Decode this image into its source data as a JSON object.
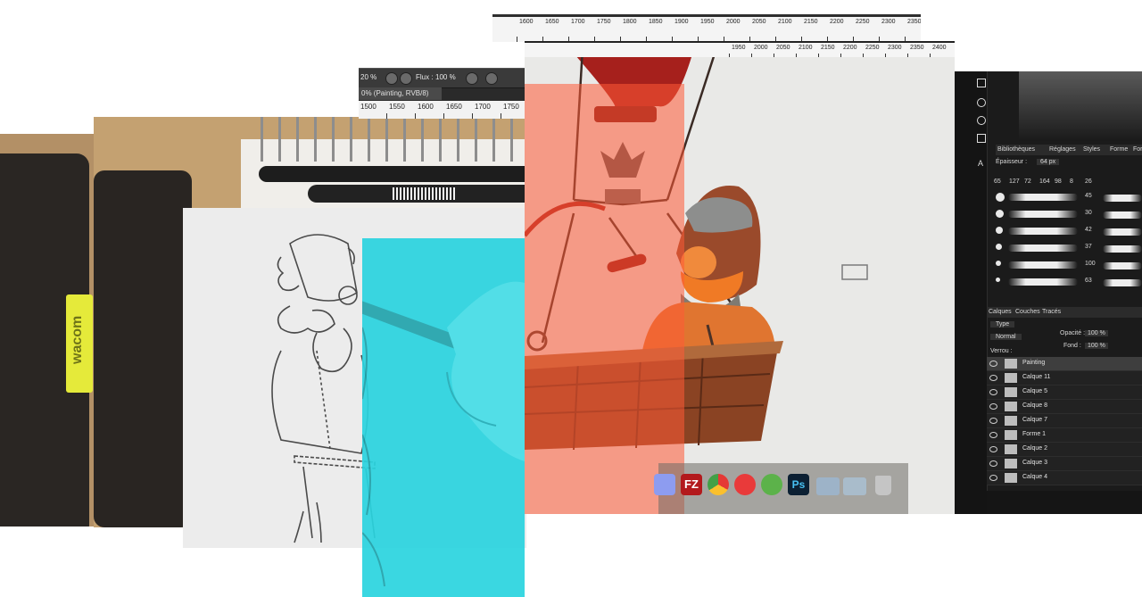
{
  "tablet_brand": "wacom",
  "toolbar": {
    "zoom_value": "20 %",
    "flux_label": "Flux :",
    "flux_value": "100 %",
    "doc_tab": "0% (Painting, RVB/8)"
  },
  "ruler_small": [
    "1500",
    "1550",
    "1600",
    "1650",
    "1700",
    "1750"
  ],
  "ruler_back": [
    "1600",
    "1650",
    "1700",
    "1750",
    "1800",
    "1850",
    "1900",
    "1950",
    "2000",
    "2050",
    "2100",
    "2150",
    "2200",
    "2250",
    "2300",
    "2350"
  ],
  "ruler_front": [
    "1950",
    "2000",
    "2050",
    "2100",
    "2150",
    "2200",
    "2250",
    "2300",
    "2350",
    "2400"
  ],
  "dock_apps": [
    "finder-icon",
    "filezilla-icon",
    "chrome-icon",
    "itunes-icon",
    "spotify-icon",
    "photoshop-icon",
    "folder-icon",
    "folder-icon",
    "trash-icon"
  ],
  "dock_labels": {
    "filezilla": "FZ",
    "photoshop": "Ps"
  },
  "panels": {
    "tabs_top": [
      "Bibliothèques",
      "Réglages",
      "Styles",
      "Forme",
      "Formes prédéfinies"
    ],
    "epaisseur_label": "Épaisseur :",
    "epaisseur_value": "64 px",
    "brush_sizes": [
      "65",
      "127",
      "72",
      "164",
      "98",
      "8",
      "26"
    ],
    "brush_side_sizes": [
      "45",
      "30",
      "42",
      "37",
      "100",
      "63"
    ],
    "layer_tabs": [
      "Calques",
      "Couches",
      "Tracés"
    ],
    "type_filter": "Type",
    "blend_mode": "Normal",
    "opacity_label": "Opacité :",
    "opacity_value": "100 %",
    "fill_label": "Fond :",
    "fill_value": "100 %",
    "lock_label": "Verrou :",
    "layers": [
      "Painting",
      "Calque 11",
      "Calque 5",
      "Calque 8",
      "Calque 7",
      "Forme 1",
      "Calque 2",
      "Calque 3",
      "Calque 4"
    ]
  },
  "colors": {
    "cyan_overlay": "#2ad4df",
    "red_overlay": "#ff5a36",
    "balloon_red": "#a6201c",
    "wood_bg": "#c4a171"
  }
}
